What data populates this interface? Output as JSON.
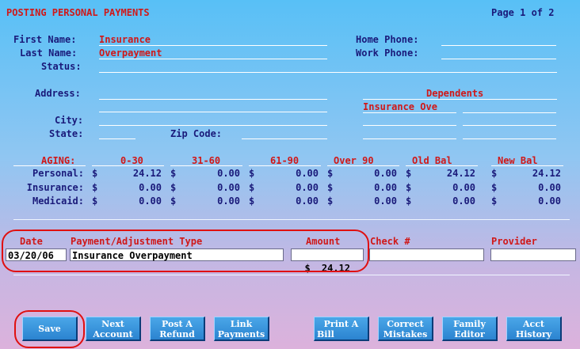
{
  "screen": {
    "title": "POSTING PERSONAL PAYMENTS",
    "page_indicator": "Page 1 of 2"
  },
  "patient": {
    "first_name_label": "First Name:",
    "first_name": "Insurance",
    "last_name_label": "Last Name:",
    "last_name": "Overpayment",
    "status_label": "Status:",
    "home_phone_label": "Home Phone:",
    "work_phone_label": "Work Phone:",
    "address_label": "Address:",
    "city_label": "City:",
    "state_label": "State:",
    "zip_label": "Zip Code:",
    "dependents_label": "Dependents",
    "dependent_1": "Insurance Ove"
  },
  "aging": {
    "headers": [
      "AGING:",
      "0-30",
      "31-60",
      "61-90",
      "Over 90",
      "Old Bal",
      "New Bal"
    ],
    "rows": [
      {
        "label": "Personal:",
        "values": [
          "24.12",
          "0.00",
          "0.00",
          "0.00",
          "24.12",
          "24.12"
        ]
      },
      {
        "label": "Insurance:",
        "values": [
          "0.00",
          "0.00",
          "0.00",
          "0.00",
          "0.00",
          "0.00"
        ]
      },
      {
        "label": "Medicaid:",
        "values": [
          "0.00",
          "0.00",
          "0.00",
          "0.00",
          "0.00",
          "0.00"
        ]
      }
    ],
    "currency": "$"
  },
  "payment": {
    "date_label": "Date",
    "date_value": "03/20/06",
    "type_label": "Payment/Adjustment Type",
    "type_value": "Insurance Overpayment",
    "amount_label": "Amount",
    "amount_currency": "$",
    "amount_value": "24.12",
    "check_label": "Check #",
    "check_value": "",
    "provider_label": "Provider",
    "provider_value": ""
  },
  "buttons": {
    "save": [
      "Save"
    ],
    "next_account": [
      "Next",
      "Account"
    ],
    "post_refund": [
      "Post A",
      "Refund"
    ],
    "link_payments": [
      "Link",
      "Payments"
    ],
    "print_bill": [
      "Print A",
      "Bill"
    ],
    "correct_mistakes": [
      "Correct",
      "Mistakes"
    ],
    "family_editor": [
      "Family",
      "Editor"
    ],
    "acct_history": [
      "Acct",
      "History"
    ]
  },
  "colors": {
    "accent_red": "#d01818",
    "label_navy": "#1a1a7a",
    "button_blue": "#2b83d0",
    "annotation_red": "#e01010"
  }
}
